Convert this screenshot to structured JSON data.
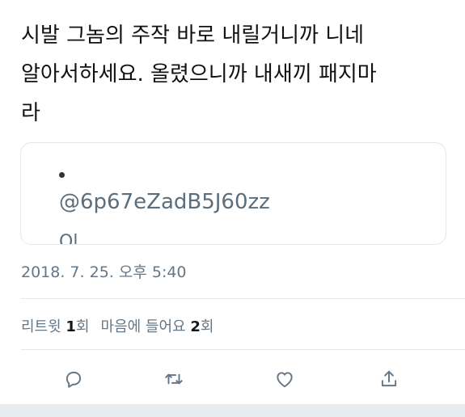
{
  "tweet": {
    "lines": [
      "시발 그놈의 주작 바로 내릴거니까 니네",
      "알아서하세요. 올렸으니까 내새끼 패지마",
      "라"
    ]
  },
  "quoted": {
    "bullet": "•",
    "handle": "@6p67eZadB5J60zz",
    "cutoff_text": "Ol"
  },
  "timestamp": "2018. 7. 25. 오후 5:40",
  "stats": {
    "retweets_label": "리트윗",
    "retweets_count": "1",
    "retweets_suffix": "회",
    "likes_label": "마음에 들어요",
    "likes_count": "2",
    "likes_suffix": "회"
  },
  "actions": {
    "reply_icon": "reply-icon",
    "retweet_icon": "retweet-icon",
    "like_icon": "heart-icon",
    "share_icon": "share-icon"
  },
  "colors": {
    "text": "#111111",
    "secondary": "#657786",
    "border": "#e1e8ed",
    "bottom_bar": "#e6ecf0"
  }
}
